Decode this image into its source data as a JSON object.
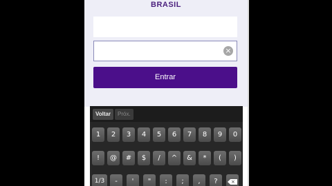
{
  "brand": {
    "title": "BRASIL"
  },
  "form": {
    "username_value": "",
    "password_value": "",
    "clear_icon": "×",
    "submit_label": "Entrar"
  },
  "keyboard": {
    "nav": {
      "prev_label": "Voltar",
      "next_label": "Próx."
    },
    "row1": [
      "1",
      "2",
      "3",
      "4",
      "5",
      "6",
      "7",
      "8",
      "9",
      "0"
    ],
    "row2": [
      "!",
      "@",
      "#",
      "$",
      "/",
      "^",
      "&",
      "*",
      "(",
      ")"
    ],
    "row3": [
      "1/3",
      "-",
      "'",
      "\"",
      ":",
      ";",
      ",",
      "?"
    ],
    "backspace_icon": "×"
  },
  "colors": {
    "accent": "#4b0f8a",
    "brand": "#4a1f7d",
    "background": "#eeeef7"
  }
}
